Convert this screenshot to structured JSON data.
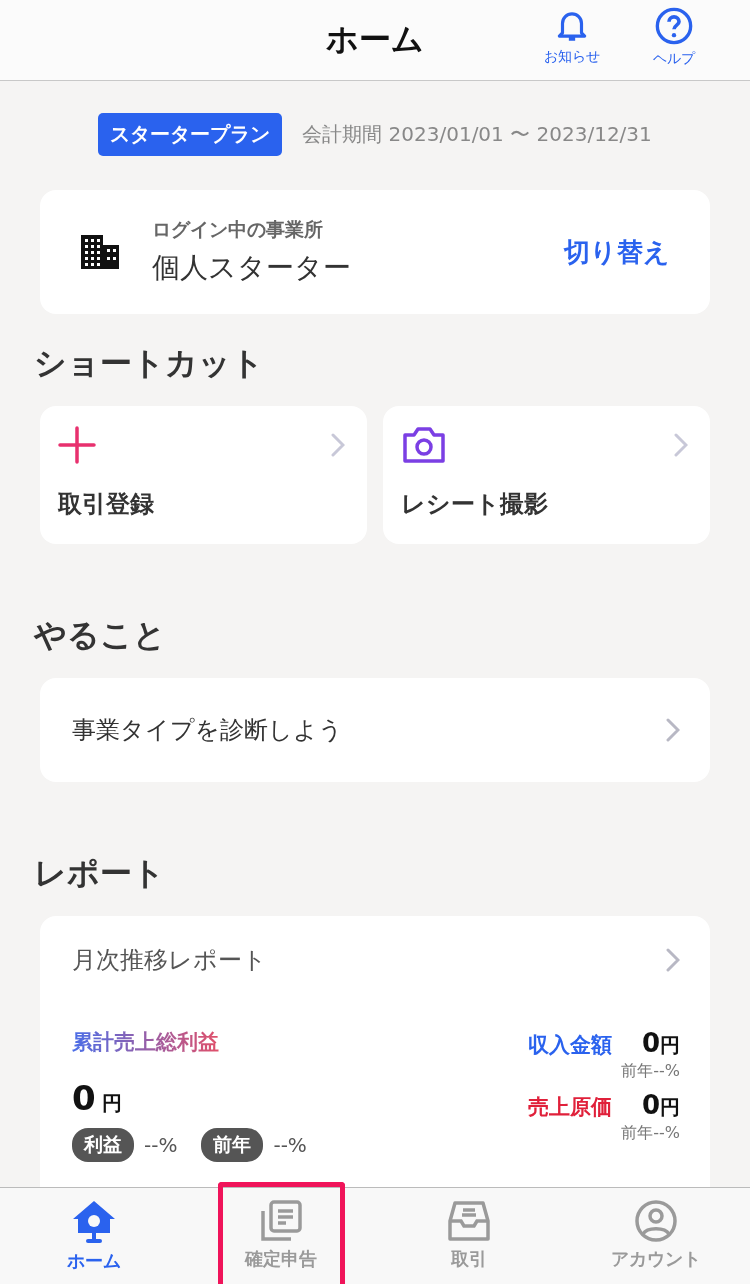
{
  "header": {
    "title": "ホーム",
    "actions": [
      {
        "kind": "bell",
        "label": "お知らせ"
      },
      {
        "kind": "help",
        "label": "ヘルプ"
      }
    ]
  },
  "plan": {
    "badge": "スタータープラン",
    "period": "会計期間 2023/01/01 〜 2023/12/31"
  },
  "office": {
    "caption": "ログイン中の事業所",
    "name": "個人スターター",
    "action": "切り替え"
  },
  "shortcuts": {
    "title": "ショートカット",
    "items": [
      {
        "kind": "plus",
        "label": "取引登録"
      },
      {
        "kind": "camera",
        "label": "レシート撮影"
      }
    ]
  },
  "todo": {
    "title": "やること",
    "items": [
      {
        "label": "事業タイプを診断しよう"
      }
    ]
  },
  "report": {
    "title": "レポート",
    "card_title": "月次推移レポート",
    "total_label": "累計売上総利益",
    "total_value": "0",
    "total_unit": "円",
    "pills": [
      {
        "label": "利益",
        "value": "--%"
      },
      {
        "label": "前年",
        "value": "--%"
      }
    ],
    "rows": [
      {
        "label": "収入金額",
        "color": "#2a62ee",
        "value": "0",
        "unit": "円",
        "sub": "前年--%"
      },
      {
        "label": "売上原価",
        "color": "#e0203a",
        "value": "0",
        "unit": "円",
        "sub": "前年--%"
      }
    ]
  },
  "tabbar": [
    {
      "kind": "home",
      "label": "ホーム",
      "selected": true,
      "highlighted": false
    },
    {
      "kind": "docs",
      "label": "確定申告",
      "selected": false,
      "highlighted": true
    },
    {
      "kind": "inbox",
      "label": "取引",
      "selected": false,
      "highlighted": false
    },
    {
      "kind": "account",
      "label": "アカウント",
      "selected": false,
      "highlighted": false
    }
  ]
}
